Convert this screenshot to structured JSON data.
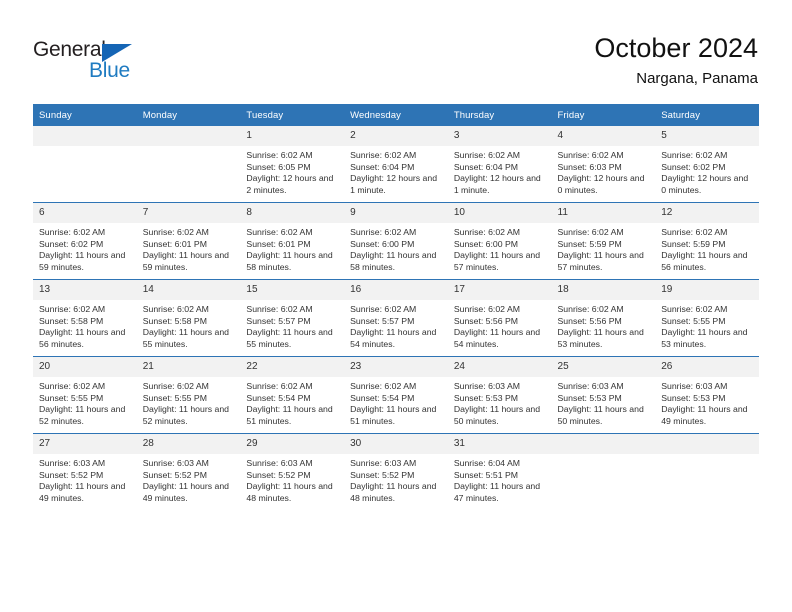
{
  "brand": {
    "name_top": "General",
    "name_bottom": "Blue",
    "accent_color": "#1f7bc1",
    "triangle_color": "#1565b5"
  },
  "header": {
    "title": "October 2024",
    "subtitle": "Nargana, Panama"
  },
  "theme": {
    "header_bar_color": "#2e74b5",
    "daynum_band_color": "#f2f2f2",
    "text_color": "#333333"
  },
  "weekday_headers": [
    "Sunday",
    "Monday",
    "Tuesday",
    "Wednesday",
    "Thursday",
    "Friday",
    "Saturday"
  ],
  "labels": {
    "sunrise": "Sunrise:",
    "sunset": "Sunset:",
    "daylight": "Daylight:"
  },
  "weeks": [
    [
      {
        "day": "",
        "sunrise": "",
        "sunset": "",
        "daylight": "",
        "empty": true
      },
      {
        "day": "",
        "sunrise": "",
        "sunset": "",
        "daylight": "",
        "empty": true
      },
      {
        "day": "1",
        "sunrise": "Sunrise: 6:02 AM",
        "sunset": "Sunset: 6:05 PM",
        "daylight": "Daylight: 12 hours and 2 minutes."
      },
      {
        "day": "2",
        "sunrise": "Sunrise: 6:02 AM",
        "sunset": "Sunset: 6:04 PM",
        "daylight": "Daylight: 12 hours and 1 minute."
      },
      {
        "day": "3",
        "sunrise": "Sunrise: 6:02 AM",
        "sunset": "Sunset: 6:04 PM",
        "daylight": "Daylight: 12 hours and 1 minute."
      },
      {
        "day": "4",
        "sunrise": "Sunrise: 6:02 AM",
        "sunset": "Sunset: 6:03 PM",
        "daylight": "Daylight: 12 hours and 0 minutes."
      },
      {
        "day": "5",
        "sunrise": "Sunrise: 6:02 AM",
        "sunset": "Sunset: 6:02 PM",
        "daylight": "Daylight: 12 hours and 0 minutes."
      }
    ],
    [
      {
        "day": "6",
        "sunrise": "Sunrise: 6:02 AM",
        "sunset": "Sunset: 6:02 PM",
        "daylight": "Daylight: 11 hours and 59 minutes."
      },
      {
        "day": "7",
        "sunrise": "Sunrise: 6:02 AM",
        "sunset": "Sunset: 6:01 PM",
        "daylight": "Daylight: 11 hours and 59 minutes."
      },
      {
        "day": "8",
        "sunrise": "Sunrise: 6:02 AM",
        "sunset": "Sunset: 6:01 PM",
        "daylight": "Daylight: 11 hours and 58 minutes."
      },
      {
        "day": "9",
        "sunrise": "Sunrise: 6:02 AM",
        "sunset": "Sunset: 6:00 PM",
        "daylight": "Daylight: 11 hours and 58 minutes."
      },
      {
        "day": "10",
        "sunrise": "Sunrise: 6:02 AM",
        "sunset": "Sunset: 6:00 PM",
        "daylight": "Daylight: 11 hours and 57 minutes."
      },
      {
        "day": "11",
        "sunrise": "Sunrise: 6:02 AM",
        "sunset": "Sunset: 5:59 PM",
        "daylight": "Daylight: 11 hours and 57 minutes."
      },
      {
        "day": "12",
        "sunrise": "Sunrise: 6:02 AM",
        "sunset": "Sunset: 5:59 PM",
        "daylight": "Daylight: 11 hours and 56 minutes."
      }
    ],
    [
      {
        "day": "13",
        "sunrise": "Sunrise: 6:02 AM",
        "sunset": "Sunset: 5:58 PM",
        "daylight": "Daylight: 11 hours and 56 minutes."
      },
      {
        "day": "14",
        "sunrise": "Sunrise: 6:02 AM",
        "sunset": "Sunset: 5:58 PM",
        "daylight": "Daylight: 11 hours and 55 minutes."
      },
      {
        "day": "15",
        "sunrise": "Sunrise: 6:02 AM",
        "sunset": "Sunset: 5:57 PM",
        "daylight": "Daylight: 11 hours and 55 minutes."
      },
      {
        "day": "16",
        "sunrise": "Sunrise: 6:02 AM",
        "sunset": "Sunset: 5:57 PM",
        "daylight": "Daylight: 11 hours and 54 minutes."
      },
      {
        "day": "17",
        "sunrise": "Sunrise: 6:02 AM",
        "sunset": "Sunset: 5:56 PM",
        "daylight": "Daylight: 11 hours and 54 minutes."
      },
      {
        "day": "18",
        "sunrise": "Sunrise: 6:02 AM",
        "sunset": "Sunset: 5:56 PM",
        "daylight": "Daylight: 11 hours and 53 minutes."
      },
      {
        "day": "19",
        "sunrise": "Sunrise: 6:02 AM",
        "sunset": "Sunset: 5:55 PM",
        "daylight": "Daylight: 11 hours and 53 minutes."
      }
    ],
    [
      {
        "day": "20",
        "sunrise": "Sunrise: 6:02 AM",
        "sunset": "Sunset: 5:55 PM",
        "daylight": "Daylight: 11 hours and 52 minutes."
      },
      {
        "day": "21",
        "sunrise": "Sunrise: 6:02 AM",
        "sunset": "Sunset: 5:55 PM",
        "daylight": "Daylight: 11 hours and 52 minutes."
      },
      {
        "day": "22",
        "sunrise": "Sunrise: 6:02 AM",
        "sunset": "Sunset: 5:54 PM",
        "daylight": "Daylight: 11 hours and 51 minutes."
      },
      {
        "day": "23",
        "sunrise": "Sunrise: 6:02 AM",
        "sunset": "Sunset: 5:54 PM",
        "daylight": "Daylight: 11 hours and 51 minutes."
      },
      {
        "day": "24",
        "sunrise": "Sunrise: 6:03 AM",
        "sunset": "Sunset: 5:53 PM",
        "daylight": "Daylight: 11 hours and 50 minutes."
      },
      {
        "day": "25",
        "sunrise": "Sunrise: 6:03 AM",
        "sunset": "Sunset: 5:53 PM",
        "daylight": "Daylight: 11 hours and 50 minutes."
      },
      {
        "day": "26",
        "sunrise": "Sunrise: 6:03 AM",
        "sunset": "Sunset: 5:53 PM",
        "daylight": "Daylight: 11 hours and 49 minutes."
      }
    ],
    [
      {
        "day": "27",
        "sunrise": "Sunrise: 6:03 AM",
        "sunset": "Sunset: 5:52 PM",
        "daylight": "Daylight: 11 hours and 49 minutes."
      },
      {
        "day": "28",
        "sunrise": "Sunrise: 6:03 AM",
        "sunset": "Sunset: 5:52 PM",
        "daylight": "Daylight: 11 hours and 49 minutes."
      },
      {
        "day": "29",
        "sunrise": "Sunrise: 6:03 AM",
        "sunset": "Sunset: 5:52 PM",
        "daylight": "Daylight: 11 hours and 48 minutes."
      },
      {
        "day": "30",
        "sunrise": "Sunrise: 6:03 AM",
        "sunset": "Sunset: 5:52 PM",
        "daylight": "Daylight: 11 hours and 48 minutes."
      },
      {
        "day": "31",
        "sunrise": "Sunrise: 6:04 AM",
        "sunset": "Sunset: 5:51 PM",
        "daylight": "Daylight: 11 hours and 47 minutes."
      },
      {
        "day": "",
        "sunrise": "",
        "sunset": "",
        "daylight": "",
        "empty": true
      },
      {
        "day": "",
        "sunrise": "",
        "sunset": "",
        "daylight": "",
        "empty": true
      }
    ]
  ]
}
